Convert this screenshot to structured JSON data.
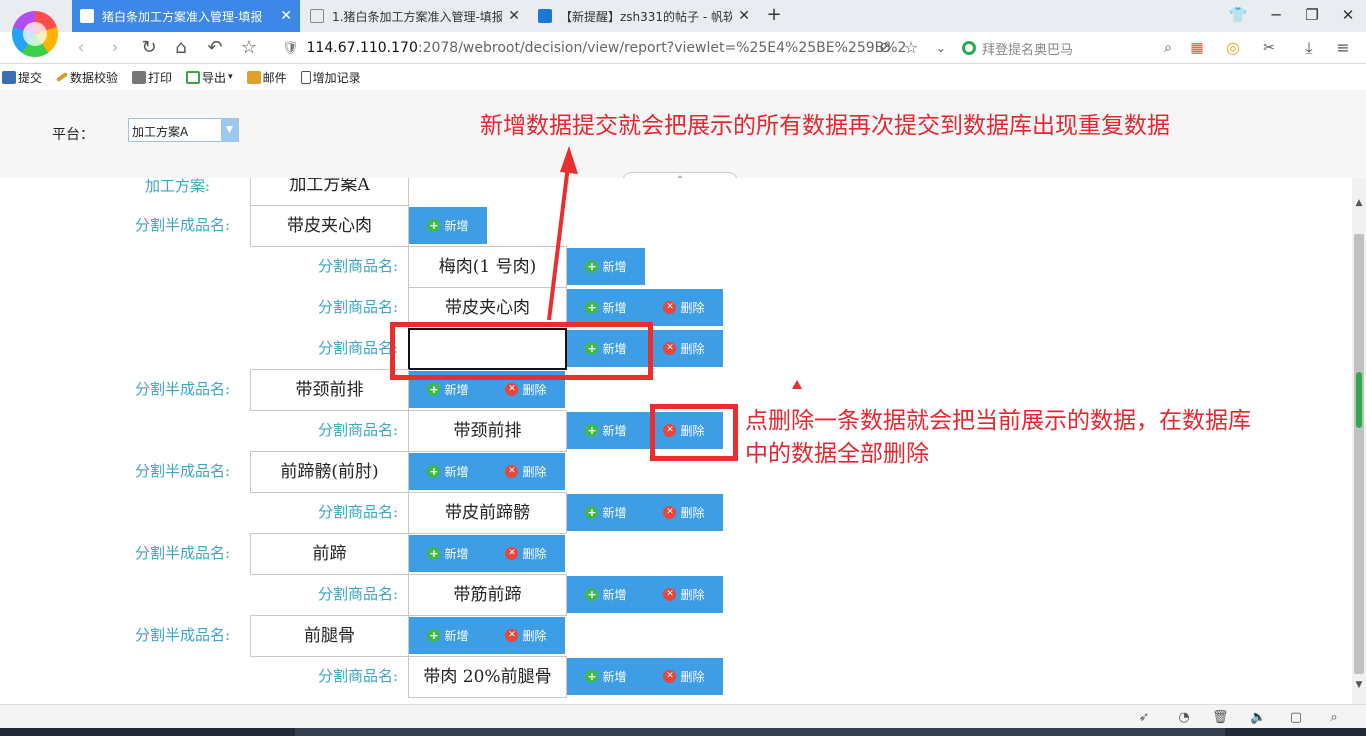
{
  "browser": {
    "tabs": [
      {
        "title": "猪白条加工方案准入管理-填报",
        "active": true
      },
      {
        "title": "1.猪白条加工方案准入管理-填报",
        "active": false
      },
      {
        "title": "【新提醒】zsh331的帖子 - 帆软",
        "active": false
      }
    ],
    "new_tab": "+",
    "address": {
      "host": "114.67.110.170",
      "rest": ":2078/webroot/decision/view/report?viewlet=%25E4%25BE%259B%2"
    },
    "search_placeholder": "拜登提名奥巴马"
  },
  "toolbar": {
    "items": [
      {
        "label": "提交",
        "icon": "submit-icon",
        "color": "#3a6fb5"
      },
      {
        "label": "数据校验",
        "icon": "pencil-check-icon",
        "color": "#d79a2b"
      },
      {
        "label": "打印",
        "icon": "printer-icon",
        "color": "#666666"
      },
      {
        "label": "导出",
        "icon": "export-icon",
        "color": "#3aa34a",
        "dropdown": "▾"
      },
      {
        "label": "邮件",
        "icon": "mail-icon",
        "color": "#e0a02c"
      },
      {
        "label": "增加记录",
        "icon": "add-record-icon",
        "color": "#555555"
      }
    ]
  },
  "params": {
    "platform_label": "平台：",
    "platform_value": "加工方案A"
  },
  "report": {
    "top_label": "加工方案:",
    "top_value": "加工方案A",
    "add_label": "新增",
    "delete_label": "删除",
    "semi_label": "分割半成品名:",
    "goods_label": "分割商品名:",
    "rows": [
      {
        "kind": "semi",
        "value": "带皮夹心肉"
      },
      {
        "kind": "goods",
        "value": "梅肉(1 号肉)"
      },
      {
        "kind": "goods",
        "value": "带皮夹心肉"
      },
      {
        "kind": "goods",
        "value": ""
      },
      {
        "kind": "semi",
        "value": "带颈前排"
      },
      {
        "kind": "goods",
        "value": "带颈前排"
      },
      {
        "kind": "semi",
        "value": "前蹄髈(前肘)"
      },
      {
        "kind": "goods",
        "value": "带皮前蹄髈"
      },
      {
        "kind": "semi",
        "value": "前蹄"
      },
      {
        "kind": "goods",
        "value": "带筋前蹄"
      },
      {
        "kind": "semi",
        "value": "前腿骨"
      },
      {
        "kind": "goods",
        "value": "带肉 20%前腿骨"
      }
    ]
  },
  "annotations": {
    "top_note": "新增数据提交就会把展示的所有数据再次提交到数据库出现重复数据",
    "side_note_line1": "点删除一条数据就会把当前展示的数据，在数据库",
    "side_note_line2": "中的数据全部删除",
    "color": "#e8262f"
  }
}
